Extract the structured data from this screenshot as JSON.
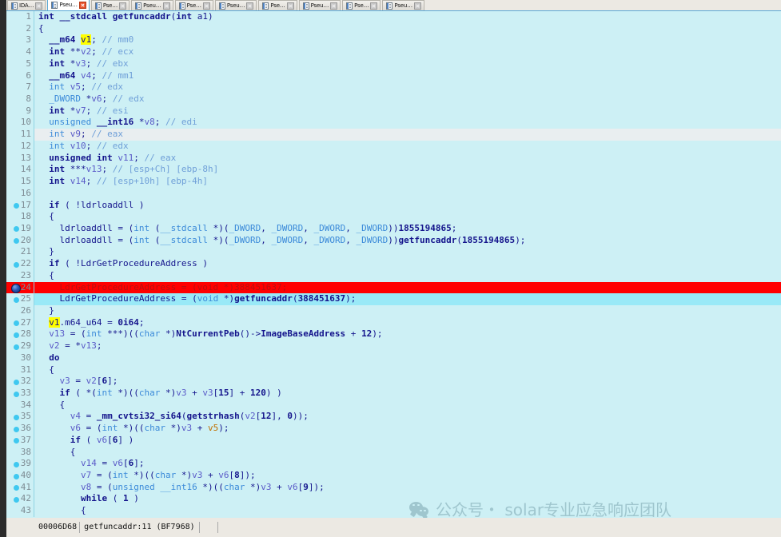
{
  "window": {
    "app": "IDA Pro - Pseudocode view",
    "tabs": [
      {
        "label": "IDA…",
        "active": false,
        "close_icon": "close-icon"
      },
      {
        "label": "Pseu…",
        "active": true,
        "close_icon": "close-icon"
      },
      {
        "label": "Pse…",
        "active": false,
        "close_icon": "close-icon"
      },
      {
        "label": "Pseu…",
        "active": false,
        "close_icon": "close-icon"
      },
      {
        "label": "Pse…",
        "active": false,
        "close_icon": "close-icon"
      },
      {
        "label": "Pseu…",
        "active": false,
        "close_icon": "close-icon"
      },
      {
        "label": "Pse…",
        "active": false,
        "close_icon": "close-icon"
      },
      {
        "label": "Pseu…",
        "active": false,
        "close_icon": "close-icon"
      },
      {
        "label": "Pse…",
        "active": false,
        "close_icon": "close-icon"
      },
      {
        "label": "Pseu…",
        "active": false,
        "close_icon": "close-icon"
      }
    ]
  },
  "statusbar": {
    "address": "00006D68",
    "location": "getfuncaddr:11",
    "offset": "(BF7968)"
  },
  "watermark": {
    "icon": "wechat-icon",
    "text": "公众号・ solar专业应急响应团队"
  },
  "colors": {
    "editor_bg": "#cdf0f5",
    "breakpoint_row": "#ff0000",
    "selected_row": "#99e9f7",
    "current_line": "#e9eef0",
    "gutter_dot": "#3fc8f0",
    "keyword": "#14148c",
    "type": "#3b8ad9",
    "comment": "#6f9fd8",
    "highlight_ident": "#ffff00",
    "watermark": "#9fc6ce"
  },
  "code": {
    "function_name": "getfuncaddr",
    "lines": [
      {
        "n": 1,
        "bp": false,
        "state": "",
        "html": "<span class=\"k\">int</span> <span class=\"k\">__stdcall</span> <span class=\"f\">getfuncaddr</span>(<span class=\"k\">int</span> <span class=\"n\">a1</span>)",
        "text": "int __stdcall getfuncaddr(int a1)"
      },
      {
        "n": 2,
        "bp": false,
        "state": "",
        "html": "{",
        "text": "{"
      },
      {
        "n": 3,
        "bp": false,
        "state": "",
        "html": "  <span class=\"k\">__m64</span> <span class=\"hi\">v1</span>; <span class=\"c\">// mm0</span>",
        "text": "  __m64 v1; // mm0"
      },
      {
        "n": 4,
        "bp": false,
        "state": "",
        "html": "  <span class=\"k\">int</span> **<span class=\"v\">v2</span>; <span class=\"c\">// ecx</span>",
        "text": "  int **v2; // ecx"
      },
      {
        "n": 5,
        "bp": false,
        "state": "",
        "html": "  <span class=\"k\">int</span> *<span class=\"v\">v3</span>; <span class=\"c\">// ebx</span>",
        "text": "  int *v3; // ebx"
      },
      {
        "n": 6,
        "bp": false,
        "state": "",
        "html": "  <span class=\"k\">__m64</span> <span class=\"v\">v4</span>; <span class=\"c\">// mm1</span>",
        "text": "  __m64 v4; // mm1"
      },
      {
        "n": 7,
        "bp": false,
        "state": "",
        "html": "  <span class=\"t\">int</span> <span class=\"v\">v5</span>; <span class=\"c\">// edx</span>",
        "text": "  int v5; // edx"
      },
      {
        "n": 8,
        "bp": false,
        "state": "",
        "html": "  <span class=\"t\">_DWORD</span> *<span class=\"v\">v6</span>; <span class=\"c\">// edx</span>",
        "text": "  _DWORD *v6; // edx"
      },
      {
        "n": 9,
        "bp": false,
        "state": "",
        "html": "  <span class=\"k\">int</span> *<span class=\"v\">v7</span>; <span class=\"c\">// esi</span>",
        "text": "  int *v7; // esi"
      },
      {
        "n": 10,
        "bp": false,
        "state": "",
        "html": "  <span class=\"t\">unsigned</span> <span class=\"k\">__int16</span> *<span class=\"v\">v8</span>; <span class=\"c\">// edi</span>",
        "text": "  unsigned __int16 *v8; // edi"
      },
      {
        "n": 11,
        "bp": false,
        "state": "gray",
        "html": "  <span class=\"t\">int</span> <span class=\"v\">v9</span>; <span class=\"c\">// eax</span>",
        "text": "  int v9; // eax"
      },
      {
        "n": 12,
        "bp": false,
        "state": "",
        "html": "  <span class=\"t\">int</span> <span class=\"v\">v10</span>; <span class=\"c\">// edx</span>",
        "text": "  int v10; // edx"
      },
      {
        "n": 13,
        "bp": false,
        "state": "",
        "html": "  <span class=\"k\">unsigned int</span> <span class=\"v\">v11</span>; <span class=\"c\">// eax</span>",
        "text": "  unsigned int v11; // eax"
      },
      {
        "n": 14,
        "bp": false,
        "state": "",
        "html": "  <span class=\"k\">int</span> ***<span class=\"v\">v13</span>; <span class=\"c\">// [esp+Ch] [ebp-8h]</span>",
        "text": "  int ***v13; // [esp+Ch] [ebp-8h]"
      },
      {
        "n": 15,
        "bp": false,
        "state": "",
        "html": "  <span class=\"k\">int</span> <span class=\"v\">v14</span>; <span class=\"c\">// [esp+10h] [ebp-4h]</span>",
        "text": "  int v14; // [esp+10h] [ebp-4h]"
      },
      {
        "n": 16,
        "bp": false,
        "state": "",
        "html": "",
        "text": ""
      },
      {
        "n": 17,
        "bp": true,
        "state": "",
        "html": "  <span class=\"k\">if</span> ( !<span class=\"n\">ldrloaddll</span> )",
        "text": "  if ( !ldrloaddll )"
      },
      {
        "n": 18,
        "bp": false,
        "state": "",
        "html": "  {",
        "text": "  {"
      },
      {
        "n": 19,
        "bp": true,
        "state": "",
        "html": "    <span class=\"n\">ldrloaddll</span> = (<span class=\"t\">int</span> (<span class=\"t\">__stdcall</span> *)(<span class=\"t\">_DWORD</span>, <span class=\"t\">_DWORD</span>, <span class=\"t\">_DWORD</span>, <span class=\"t\">_DWORD</span>))<span class=\"k\">1855194865</span>;",
        "text": "    ldrloaddll = (int (__stdcall *)(_DWORD, _DWORD, _DWORD, _DWORD))1855194865;"
      },
      {
        "n": 20,
        "bp": true,
        "state": "",
        "html": "    <span class=\"n\">ldrloaddll</span> = (<span class=\"t\">int</span> (<span class=\"t\">__stdcall</span> *)(<span class=\"t\">_DWORD</span>, <span class=\"t\">_DWORD</span>, <span class=\"t\">_DWORD</span>, <span class=\"t\">_DWORD</span>))<span class=\"f\">getfuncaddr</span>(<span class=\"k\">1855194865</span>);",
        "text": "    ldrloaddll = (int (__stdcall *)(_DWORD, _DWORD, _DWORD, _DWORD))getfuncaddr(1855194865);"
      },
      {
        "n": 21,
        "bp": false,
        "state": "",
        "html": "  }",
        "text": "  }"
      },
      {
        "n": 22,
        "bp": true,
        "state": "",
        "html": "  <span class=\"k\">if</span> ( !<span class=\"n\">LdrGetProcedureAddress</span> )",
        "text": "  if ( !LdrGetProcedureAddress )"
      },
      {
        "n": 23,
        "bp": false,
        "state": "",
        "html": "  {",
        "text": "  {"
      },
      {
        "n": 24,
        "bp": "cur",
        "state": "red",
        "html": "    LdrGetProcedureAddress = (void *)388451637;",
        "text": "    LdrGetProcedureAddress = (void *)388451637;"
      },
      {
        "n": 25,
        "bp": true,
        "state": "cyan",
        "html": "    <span class=\"n\">LdrGetProcedureAddress</span> = (<span class=\"t\">void</span> *)<span class=\"f\">getfuncaddr</span>(<span class=\"k\">388451637</span>);",
        "text": "    LdrGetProcedureAddress = (void *)getfuncaddr(388451637);"
      },
      {
        "n": 26,
        "bp": false,
        "state": "",
        "html": "  }",
        "text": "  }"
      },
      {
        "n": 27,
        "bp": true,
        "state": "",
        "html": "  <span class=\"hi\">v1</span><span class=\"n\">.m64_u64</span> = <span class=\"k\">0i64</span>;",
        "text": "  v1.m64_u64 = 0i64;"
      },
      {
        "n": 28,
        "bp": true,
        "state": "",
        "html": "  <span class=\"v\">v13</span> = (<span class=\"t\">int</span> ***)((<span class=\"t\">char</span> *)<span class=\"f\">NtCurrentPeb</span>()-&gt;<span class=\"f\">ImageBaseAddress</span> + <span class=\"k\">12</span>);",
        "text": "  v13 = (int ***)((char *)NtCurrentPeb()->ImageBaseAddress + 12);"
      },
      {
        "n": 29,
        "bp": true,
        "state": "",
        "html": "  <span class=\"v\">v2</span> = *<span class=\"v\">v13</span>;",
        "text": "  v2 = *v13;"
      },
      {
        "n": 30,
        "bp": false,
        "state": "",
        "html": "  <span class=\"k\">do</span>",
        "text": "  do"
      },
      {
        "n": 31,
        "bp": false,
        "state": "",
        "html": "  {",
        "text": "  {"
      },
      {
        "n": 32,
        "bp": true,
        "state": "",
        "html": "    <span class=\"v\">v3</span> = <span class=\"v\">v2</span>[<span class=\"k\">6</span>];",
        "text": "    v3 = v2[6];"
      },
      {
        "n": 33,
        "bp": true,
        "state": "",
        "html": "    <span class=\"k\">if</span> ( *(<span class=\"t\">int</span> *)((<span class=\"t\">char</span> *)<span class=\"v\">v3</span> + <span class=\"v\">v3</span>[<span class=\"k\">15</span>] + <span class=\"k\">120</span>) )",
        "text": "    if ( *(int *)((char *)v3 + v3[15] + 120) )"
      },
      {
        "n": 34,
        "bp": false,
        "state": "",
        "html": "    {",
        "text": "    {"
      },
      {
        "n": 35,
        "bp": true,
        "state": "",
        "html": "      <span class=\"v\">v4</span> = <span class=\"f\">_mm_cvtsi32_si64</span>(<span class=\"f\">getstrhash</span>(<span class=\"v\">v2</span>[<span class=\"k\">12</span>], <span class=\"k\">0</span>));",
        "text": "      v4 = _mm_cvtsi32_si64(getstrhash(v2[12], 0));"
      },
      {
        "n": 36,
        "bp": true,
        "state": "",
        "html": "      <span class=\"v\">v6</span> = (<span class=\"t\">int</span> *)((<span class=\"t\">char</span> *)<span class=\"v\">v3</span> + <span class=\"o\">v5</span>);",
        "text": "      v6 = (int *)((char *)v3 + v5);"
      },
      {
        "n": 37,
        "bp": true,
        "state": "",
        "html": "      <span class=\"k\">if</span> ( <span class=\"v\">v6</span>[<span class=\"k\">6</span>] )",
        "text": "      if ( v6[6] )"
      },
      {
        "n": 38,
        "bp": false,
        "state": "",
        "html": "      {",
        "text": "      {"
      },
      {
        "n": 39,
        "bp": true,
        "state": "",
        "html": "        <span class=\"v\">v14</span> = <span class=\"v\">v6</span>[<span class=\"k\">6</span>];",
        "text": "        v14 = v6[6];"
      },
      {
        "n": 40,
        "bp": true,
        "state": "",
        "html": "        <span class=\"v\">v7</span> = (<span class=\"t\">int</span> *)((<span class=\"t\">char</span> *)<span class=\"v\">v3</span> + <span class=\"v\">v6</span>[<span class=\"k\">8</span>]);",
        "text": "        v7 = (int *)((char *)v3 + v6[8]);"
      },
      {
        "n": 41,
        "bp": true,
        "state": "",
        "html": "        <span class=\"v\">v8</span> = (<span class=\"t\">unsigned</span> <span class=\"t\">__int16</span> *)((<span class=\"t\">char</span> *)<span class=\"v\">v3</span> + <span class=\"v\">v6</span>[<span class=\"k\">9</span>]);",
        "text": "        v8 = (unsigned __int16 *)((char *)v3 + v6[9]);"
      },
      {
        "n": 42,
        "bp": true,
        "state": "",
        "html": "        <span class=\"k\">while</span> ( <span class=\"k\">1</span> )",
        "text": "        while ( 1 )"
      },
      {
        "n": 43,
        "bp": false,
        "state": "",
        "html": "        {",
        "text": "        {"
      }
    ]
  }
}
